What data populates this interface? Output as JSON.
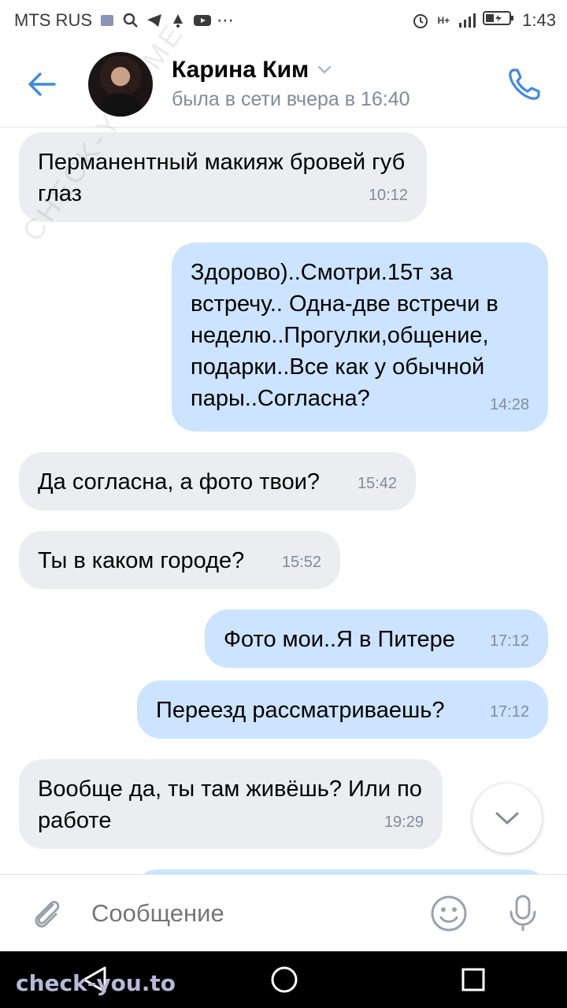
{
  "status_bar": {
    "carrier": "MTS RUS",
    "time": "1:43",
    "signal": "H+"
  },
  "header": {
    "contact_name": "Карина Ким",
    "contact_status": "была в сети вчера в 16:40"
  },
  "messages": [
    {
      "direction": "in",
      "text": "Перманентный макияж бровей губ глаз",
      "time": "10:12"
    },
    {
      "direction": "out",
      "text": "Здорово)..Смотри.15т за встречу.. Одна-две встречи в неделю..Прогулки,общение, подарки..Все как у обычной пары..Согласна?",
      "time": "14:28"
    },
    {
      "direction": "in",
      "text": "Да согласна, а фото твои?",
      "time": "15:42"
    },
    {
      "direction": "in",
      "text": "Ты в каком городе?",
      "time": "15:52"
    },
    {
      "direction": "out",
      "text": "Фото мои..Я в Питере",
      "time": "17:12"
    },
    {
      "direction": "out",
      "text": "Переезд рассматриваешь?",
      "time": "17:12"
    },
    {
      "direction": "in",
      "text": "Вообще да, ты там живёшь? Или по работе",
      "time": "19:29"
    }
  ],
  "composer": {
    "placeholder": "Сообщение"
  },
  "watermark": {
    "bottom": "check-you.to",
    "diagonal": "CHECK-YOU.ME"
  },
  "colors": {
    "accent": "#3f8ae0",
    "incoming_bubble": "#ebedf0",
    "outgoing_bubble": "#cce4ff",
    "secondary_text": "#818c99"
  },
  "icons": {
    "back": "arrow-left-icon",
    "call": "phone-icon",
    "attach": "paperclip-icon",
    "emoji": "smile-icon",
    "mic": "microphone-icon",
    "scroll": "chevron-down-icon"
  }
}
